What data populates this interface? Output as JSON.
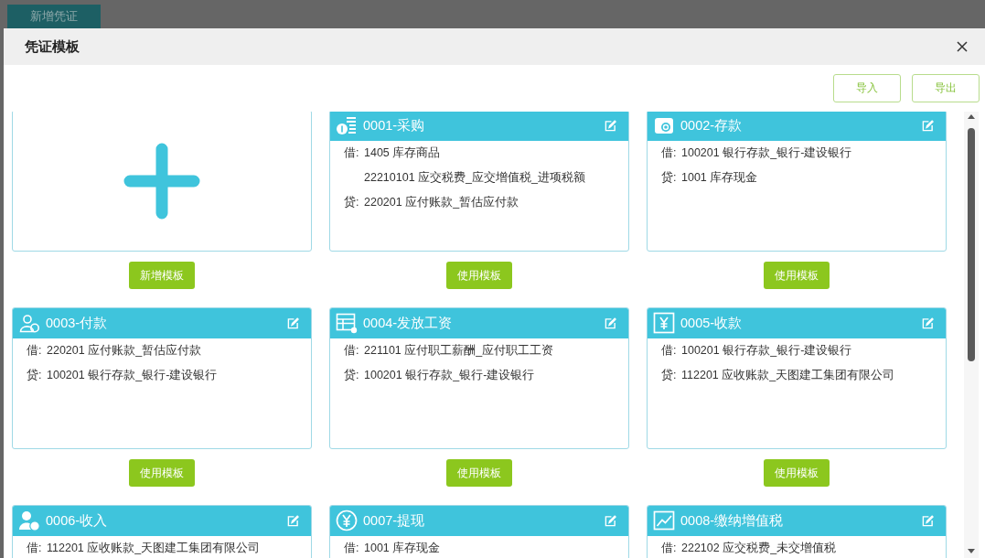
{
  "background": {
    "button": "新增凭证"
  },
  "dialog": {
    "title": "凭证模板",
    "actions": [
      "导入",
      "导出"
    ]
  },
  "templates": [
    {
      "kind": "add",
      "button": "新增模板"
    },
    {
      "kind": "template",
      "title": "0001-采购",
      "entries": [
        {
          "side": "借:",
          "accounts": [
            "1405 库存商品",
            "22210101 应交税费_应交增值税_进项税额"
          ]
        },
        {
          "side": "贷:",
          "accounts": [
            "220201 应付账款_暂估应付款"
          ]
        }
      ],
      "button": "使用模板"
    },
    {
      "kind": "template",
      "title": "0002-存款",
      "entries": [
        {
          "side": "借:",
          "accounts": [
            "100201 银行存款_银行-建设银行"
          ]
        },
        {
          "side": "贷:",
          "accounts": [
            "1001 库存现金"
          ]
        }
      ],
      "button": "使用模板"
    },
    {
      "kind": "template",
      "title": "0003-付款",
      "entries": [
        {
          "side": "借:",
          "accounts": [
            "220201 应付账款_暂估应付款"
          ]
        },
        {
          "side": "贷:",
          "accounts": [
            "100201 银行存款_银行-建设银行"
          ]
        }
      ],
      "button": "使用模板"
    },
    {
      "kind": "template",
      "title": "0004-发放工资",
      "entries": [
        {
          "side": "借:",
          "accounts": [
            "221101 应付职工薪酬_应付职工工资"
          ]
        },
        {
          "side": "贷:",
          "accounts": [
            "100201 银行存款_银行-建设银行"
          ]
        }
      ],
      "button": "使用模板"
    },
    {
      "kind": "template",
      "title": "0005-收款",
      "entries": [
        {
          "side": "借:",
          "accounts": [
            "100201 银行存款_银行-建设银行"
          ]
        },
        {
          "side": "贷:",
          "accounts": [
            "112201 应收账款_天图建工集团有限公司"
          ]
        }
      ],
      "button": "使用模板"
    },
    {
      "kind": "template",
      "title": "0006-收入",
      "entries": [
        {
          "side": "借:",
          "accounts": [
            "112201 应收账款_天图建工集团有限公司"
          ]
        }
      ]
    },
    {
      "kind": "template",
      "title": "0007-提现",
      "entries": [
        {
          "side": "借:",
          "accounts": [
            "1001 库存现金"
          ]
        }
      ]
    },
    {
      "kind": "template",
      "title": "0008-缴纳增值税",
      "entries": [
        {
          "side": "借:",
          "accounts": [
            "222102 应交税费_未交增值税"
          ]
        }
      ]
    }
  ]
}
